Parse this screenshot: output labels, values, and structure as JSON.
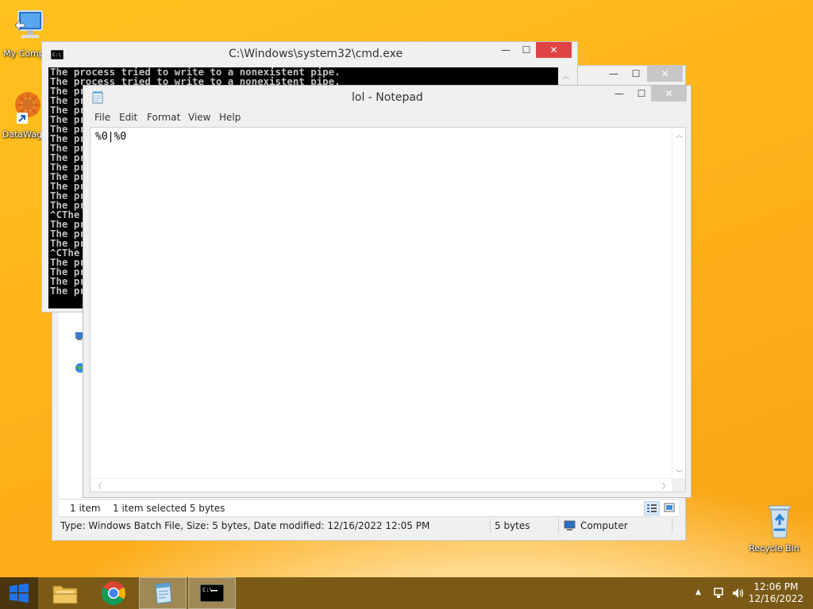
{
  "desktop": {
    "icons": [
      {
        "label": "My Comp",
        "icon": "computer-icon"
      },
      {
        "label": "DataWag",
        "icon": "datawag-icon"
      },
      {
        "label": "Recycle Bin",
        "icon": "recycle-bin-icon"
      }
    ]
  },
  "explorer": {
    "status": {
      "item_count": "1 item",
      "selection": "1 item selected  5 bytes",
      "details": "Type: Windows Batch File, Size: 5 bytes, Date modified: 12/16/2022 12:05 PM",
      "size": "5 bytes",
      "location": "Computer"
    }
  },
  "cmd": {
    "title": "C:\\Windows\\system32\\cmd.exe",
    "lines": [
      "The process tried to write to a nonexistent pipe.",
      "The process tried to write to a nonexistent pipe.",
      "The pr",
      "The pr",
      "The pr",
      "The pr",
      "The pr",
      "The pr",
      "The pr",
      "The pr",
      "The pr",
      "The pr",
      "The pr",
      "The pr",
      "The pr",
      "^CThe ",
      "The pr",
      "The pr",
      "The pr",
      "^CThe ",
      "The pr",
      "The pr",
      "The pr",
      "The pr"
    ]
  },
  "notepad": {
    "title": "lol - Notepad",
    "menu": [
      "File",
      "Edit",
      "Format",
      "View",
      "Help"
    ],
    "content": "%0|%0"
  },
  "caption": {
    "minimize": "—",
    "maximize": "☐",
    "close": "✕"
  },
  "taskbar": {
    "time": "12:06 PM",
    "date": "12/16/2022",
    "apps": [
      "file-explorer",
      "chrome",
      "notepad",
      "cmd"
    ]
  },
  "colors": {
    "close_button": "#e04343",
    "taskbar": "#7a5a16",
    "desktop": "#ffb21a"
  }
}
